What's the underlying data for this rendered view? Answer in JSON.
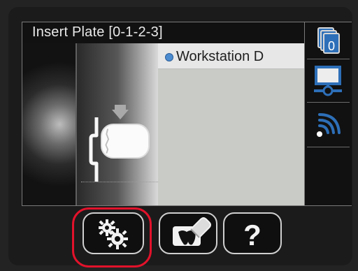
{
  "screen": {
    "title": "Insert Plate [0-1-2-3]",
    "workstation_label": "Workstation D"
  },
  "right_column": {
    "top_icon": {
      "name": "document-stack-icon",
      "badge": "0"
    },
    "mid_icon": {
      "name": "network-display-icon"
    },
    "bot_icon": {
      "name": "wifi-icon"
    }
  },
  "bottom_bar": {
    "settings_button": {
      "icon": "gears-icon"
    },
    "erase_button": {
      "icon": "erase-tooth-icon"
    },
    "help_button": {
      "label": "?"
    }
  },
  "colors": {
    "highlight": "#e2122b",
    "workstation_dot": "#4b8bd0",
    "badge_blue": "#2d6fb8"
  }
}
